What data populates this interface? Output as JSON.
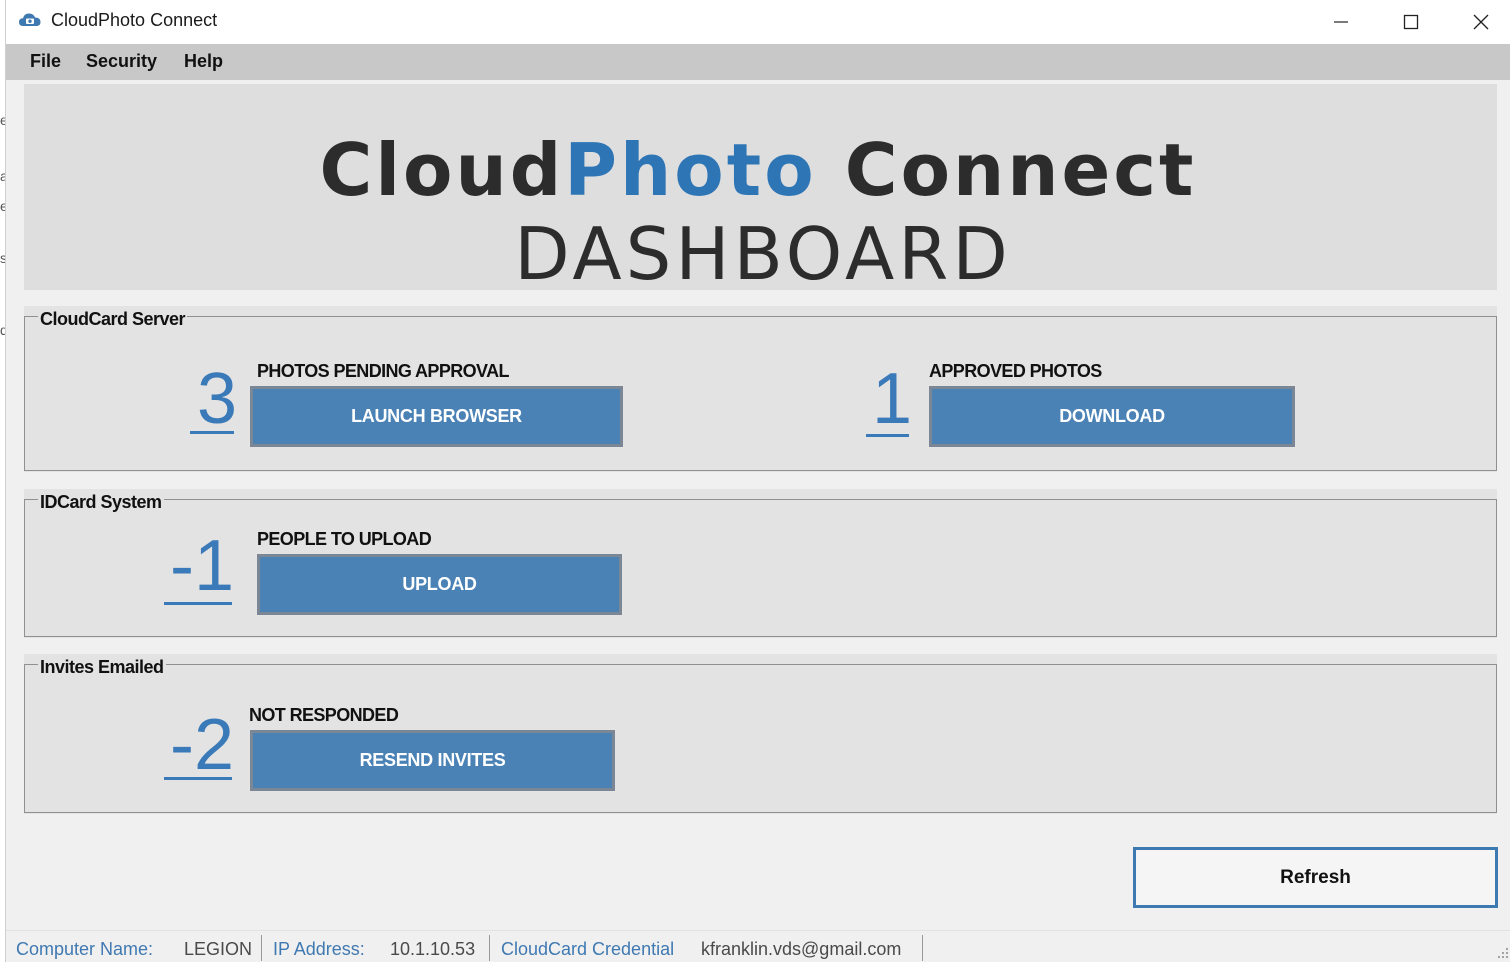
{
  "window": {
    "title": "CloudPhoto Connect",
    "icon": "cloud-camera-icon"
  },
  "menu": {
    "items": [
      "File",
      "Security",
      "Help"
    ]
  },
  "banner": {
    "title_part1": "Cloud",
    "title_part2": "Photo",
    "title_part3": " Connect",
    "subtitle": "DASHBOARD",
    "accent_color": "#2e75b6"
  },
  "sections": {
    "cloudcard": {
      "title": "CloudCard Server",
      "pending": {
        "count": "3",
        "caption": "PHOTOS PENDING APPROVAL",
        "button": "LAUNCH BROWSER"
      },
      "approved": {
        "count": "1",
        "caption": "APPROVED PHOTOS",
        "button": "DOWNLOAD"
      }
    },
    "idcard": {
      "title": "IDCard System",
      "count": "-1",
      "caption": "PEOPLE TO UPLOAD",
      "button": "UPLOAD"
    },
    "invites": {
      "title": "Invites Emailed",
      "count": "-2",
      "caption": "NOT RESPONDED",
      "button": "RESEND INVITES"
    }
  },
  "refresh_label": "Refresh",
  "status": {
    "computer_label": "Computer Name:",
    "computer_value": "LEGION",
    "ip_label": "IP Address:",
    "ip_value": "10.1.10.53",
    "credential_label": "CloudCard Credential",
    "credential_value": "kfranklin.vds@gmail.com"
  },
  "colors": {
    "number_blue": "#3b7ab8",
    "button_blue": "#4a82b5",
    "status_label_blue": "#3f79b1"
  }
}
